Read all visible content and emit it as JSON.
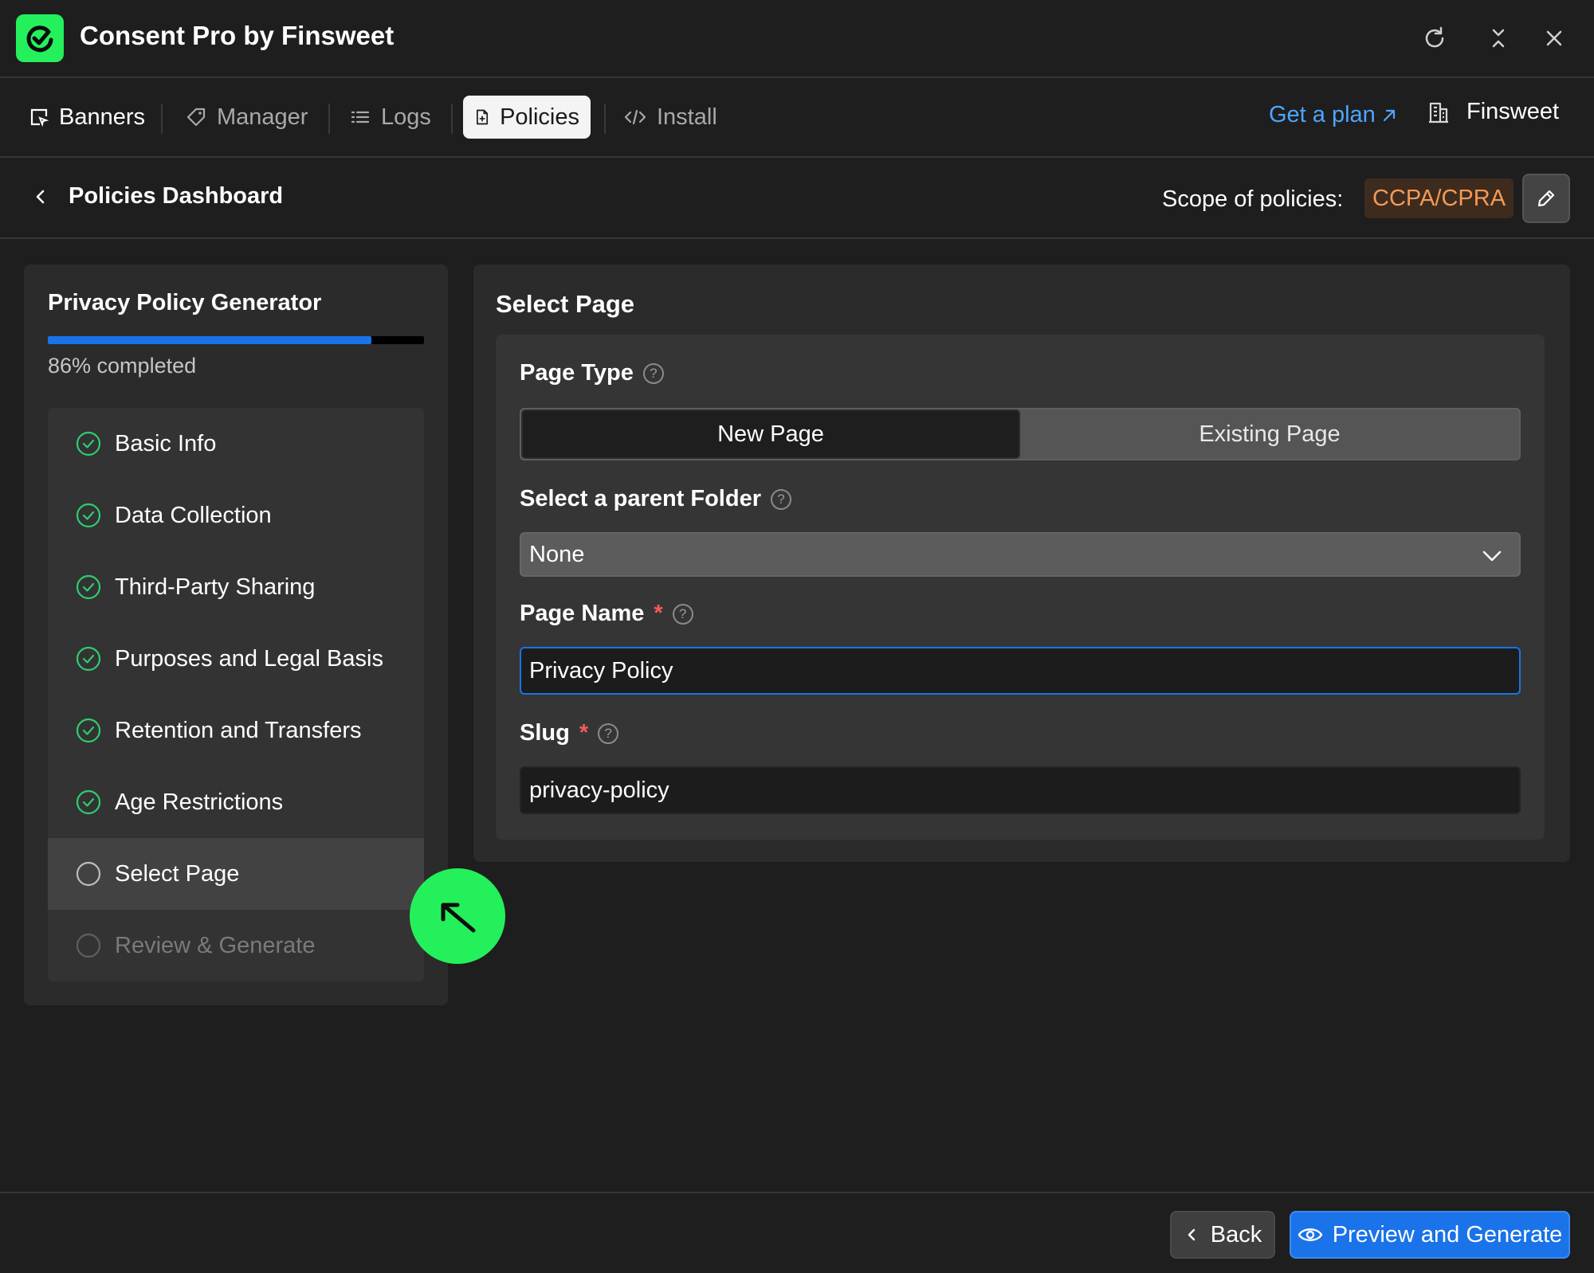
{
  "app": {
    "title": "Consent Pro by Finsweet",
    "logo_icon": "check-circle-icon",
    "brand_color": "#24f05c"
  },
  "window_controls": [
    {
      "icon": "refresh-icon"
    },
    {
      "icon": "collapse-icon"
    },
    {
      "icon": "close-icon"
    }
  ],
  "nav": {
    "tabs": [
      {
        "label": "Banners",
        "icon": "banner-icon",
        "active": false
      },
      {
        "label": "Manager",
        "icon": "tag-icon",
        "active": false
      },
      {
        "label": "Logs",
        "icon": "list-icon",
        "active": false
      },
      {
        "label": "Policies",
        "icon": "document-icon",
        "active": true
      },
      {
        "label": "Install",
        "icon": "code-icon",
        "active": false
      }
    ],
    "get_plan": "Get a plan",
    "workspace": "Finsweet"
  },
  "subheader": {
    "back_label": "Policies Dashboard",
    "scope_label": "Scope of policies:",
    "scope_value": "CCPA/CPRA"
  },
  "generator": {
    "title": "Privacy Policy Generator",
    "progress_percent": 86,
    "progress_text": "86% completed",
    "steps": [
      {
        "label": "Basic Info",
        "status": "done"
      },
      {
        "label": "Data Collection",
        "status": "done"
      },
      {
        "label": "Third-Party Sharing",
        "status": "done"
      },
      {
        "label": "Purposes and Legal Basis",
        "status": "done"
      },
      {
        "label": "Retention and Transfers",
        "status": "done"
      },
      {
        "label": "Age Restrictions",
        "status": "done"
      },
      {
        "label": "Select Page",
        "status": "current"
      },
      {
        "label": "Review & Generate",
        "status": "pending"
      }
    ]
  },
  "form": {
    "title": "Select Page",
    "page_type": {
      "label": "Page Type",
      "options": [
        "New Page",
        "Existing Page"
      ],
      "selected": "New Page"
    },
    "parent_folder": {
      "label": "Select a parent Folder",
      "value": "None"
    },
    "page_name": {
      "label": "Page Name",
      "required_mark": "*",
      "value": "Privacy Policy"
    },
    "slug": {
      "label": "Slug",
      "required_mark": "*",
      "value": "privacy-policy"
    },
    "help_glyph": "?"
  },
  "footer": {
    "back_label": "Back",
    "primary_label": "Preview and Generate"
  },
  "colors": {
    "accent": "#1a73e8",
    "scope_badge_text": "#f59a55",
    "required": "#f25c54"
  }
}
